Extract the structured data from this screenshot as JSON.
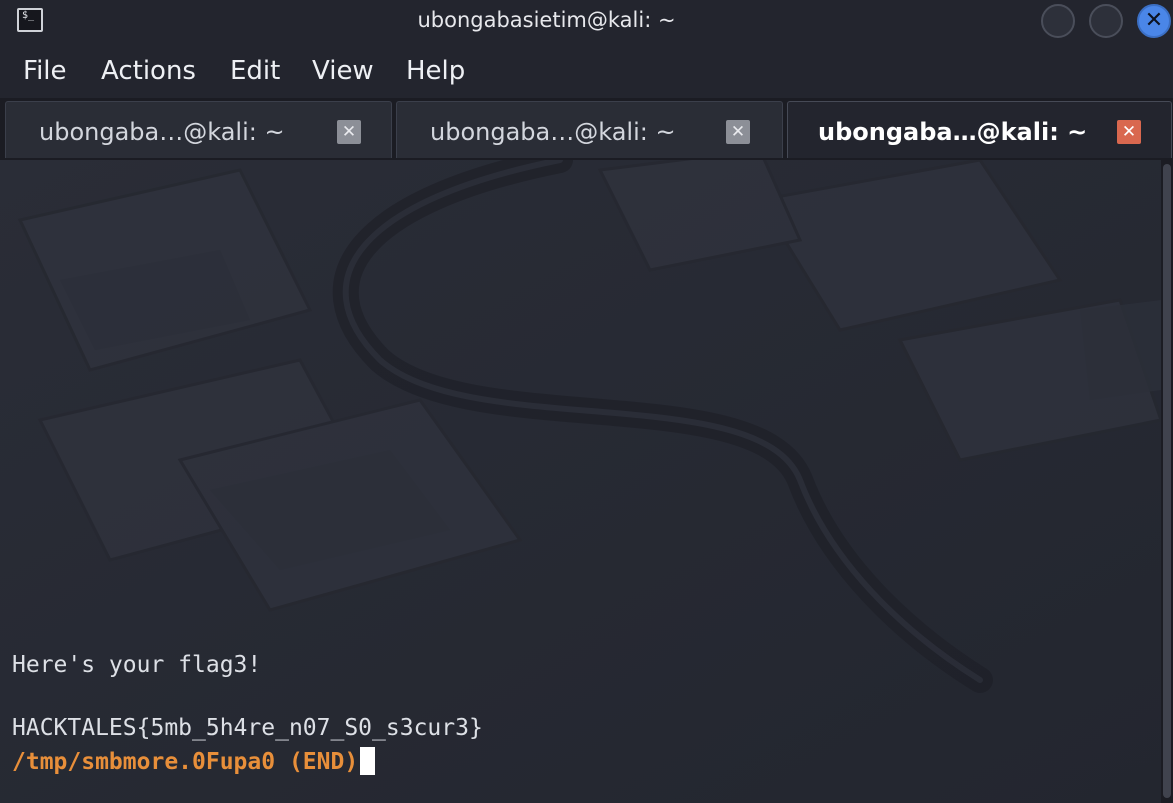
{
  "window": {
    "title": "ubongabasietim@kali: ~",
    "terminal_icon_glyph": "$_",
    "close_glyph": "✕"
  },
  "menu": [
    {
      "label": "File"
    },
    {
      "label": "Actions"
    },
    {
      "label": "Edit"
    },
    {
      "label": "View"
    },
    {
      "label": "Help"
    }
  ],
  "tabs": [
    {
      "label": "ubongaba…@kali: ~",
      "active": false,
      "close_glyph": "✕"
    },
    {
      "label": "ubongaba…@kali: ~",
      "active": false,
      "close_glyph": "✕"
    },
    {
      "label": "ubongaba…@kali: ~",
      "active": true,
      "close_glyph": "✕"
    }
  ],
  "terminal": {
    "lines": [
      "Here's your flag3!",
      "",
      "HACKTALES{5mb_5h4re_n07_S0_s3cur3}"
    ],
    "pager_prompt": "/tmp/smbmore.0Fupa0 (END)"
  },
  "colors": {
    "accent_close": "#4a86e8",
    "active_tab_close": "#d9684f",
    "prompt": "#e88f3a"
  }
}
